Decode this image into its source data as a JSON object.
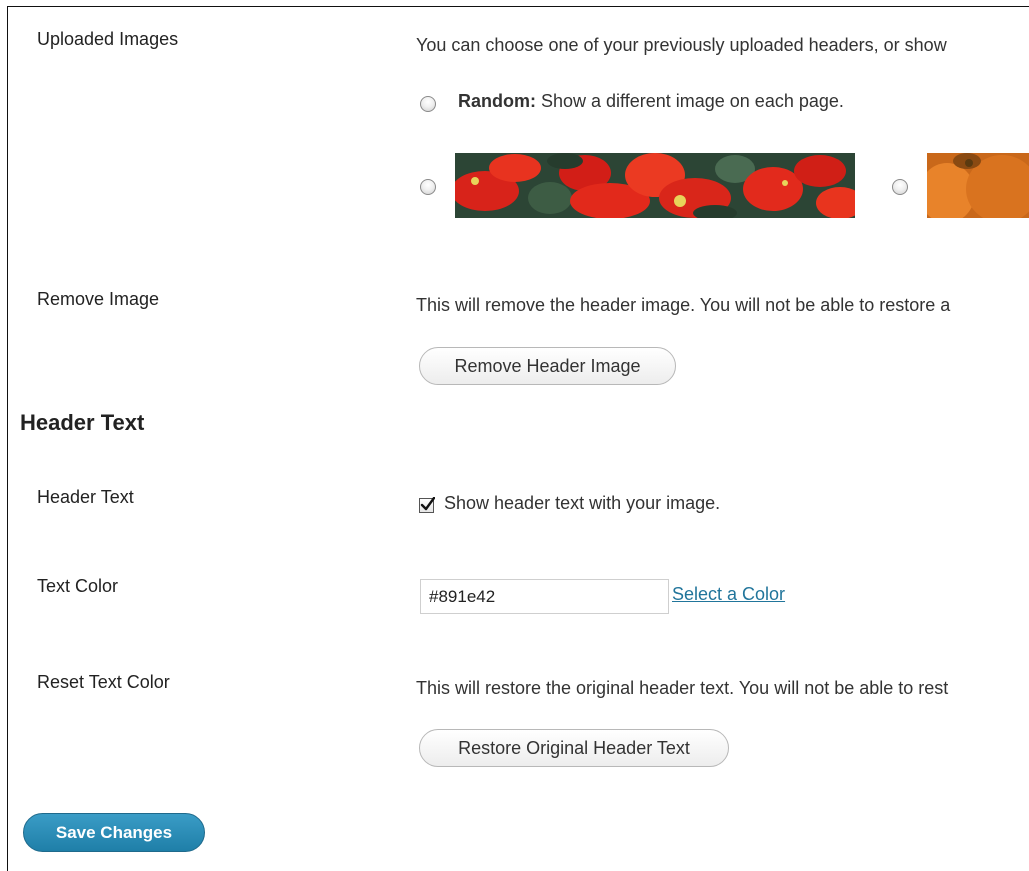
{
  "uploaded_images": {
    "label": "Uploaded Images",
    "description": "You can choose one of your previously uploaded headers, or show",
    "random_label_bold": "Random:",
    "random_label_rest": " Show a different image on each page.",
    "thumbnails": [
      "poinsettia-header",
      "pumpkin-header"
    ]
  },
  "remove_image": {
    "label": "Remove Image",
    "description": "This will remove the header image. You will not be able to restore a",
    "button": "Remove Header Image"
  },
  "header_text_section": {
    "heading": "Header Text"
  },
  "header_text": {
    "label": "Header Text",
    "checkbox_label": "Show header text with your image.",
    "checked": true
  },
  "text_color": {
    "label": "Text Color",
    "value": "#891e42",
    "link": "Select a Color"
  },
  "reset_text_color": {
    "label": "Reset Text Color",
    "description": "This will restore the original header text. You will not be able to rest",
    "button": "Restore Original Header Text"
  },
  "save_button": "Save Changes",
  "colors": {
    "link": "#21759b",
    "primary_button": "#2a8ab5",
    "poinsettia_red": "#e0261a",
    "leaf_green": "#2f4a37",
    "pumpkin_orange": "#e07a1f"
  }
}
